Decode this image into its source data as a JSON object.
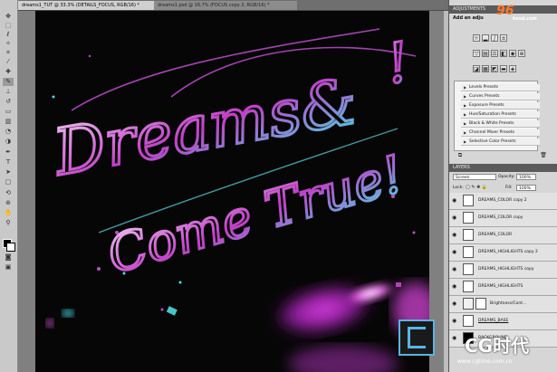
{
  "tabs": [
    {
      "label": "dreams1_TUT @ 33.3% (DETAILS_FOCUS, RGB/16) *"
    },
    {
      "label": "dreams1.psd @ 16.7% (FOCUS copy 2, RGB/16) *"
    }
  ],
  "artwork": {
    "line1": "Dreams&",
    "line2": "!",
    "line3": "Come True!"
  },
  "adjustments": {
    "title": "ADJUSTMENTS",
    "subtitle": "Add an adju",
    "presets": [
      "Levels Presets",
      "Curves Presets",
      "Exposure Presets",
      "Hue/Saturation Presets",
      "Black & White Presets",
      "Channel Mixer Presets",
      "Selective Color Presets"
    ]
  },
  "layers": {
    "title": "LAYERS",
    "blend_mode": "Screen",
    "opacity_label": "Opacity:",
    "opacity_value": "100%",
    "lock_label": "Lock:",
    "fill_label": "Fill:",
    "fill_value": "100%",
    "items": [
      {
        "name": "DREAMS_COLOR copy 2"
      },
      {
        "name": "DREAMS_COLOR copy"
      },
      {
        "name": "DREAMS_COLOR"
      },
      {
        "name": "DREAMS_HIGHLIGHTS copy 2"
      },
      {
        "name": "DREAMS_HIGHLIGHTS copy"
      },
      {
        "name": "DREAMS_HIGHLIGHTS"
      },
      {
        "name": "Brightness/Cont..."
      },
      {
        "name": "DREAMS_BASE"
      },
      {
        "name": "BACKGROUND"
      }
    ]
  },
  "watermarks": {
    "top_brand": "96",
    "top_sub": "hxsd.com",
    "bottom_brand": "CG时代",
    "bottom_url": "www.cgtime.com.cn"
  },
  "colors": {
    "accent_magenta": "#d040d0",
    "accent_cyan": "#40e0e0",
    "canvas_bg": "#060606"
  }
}
